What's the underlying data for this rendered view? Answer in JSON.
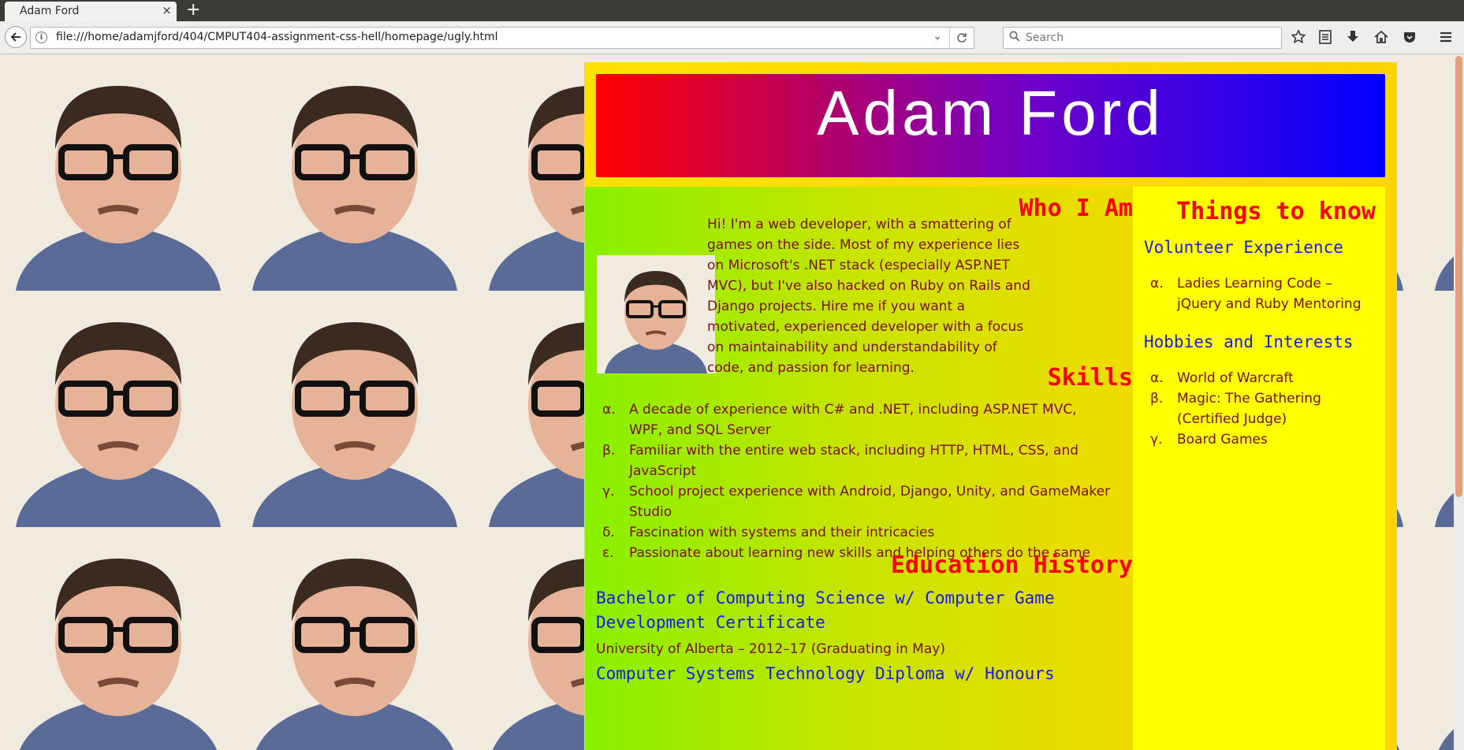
{
  "browser": {
    "tab_title": "Adam Ford",
    "tab_close": "×",
    "new_tab": "+",
    "url": "file:///home/adamjford/404/CMPUT404-assignment-css-hell/homepage/ugly.html",
    "url_dropdown": "⌄",
    "reload": "C",
    "search_placeholder": "Search",
    "toolbar_icons": [
      "bookmark-star-icon",
      "reading-list-icon",
      "download-icon",
      "home-icon",
      "pocket-icon",
      "menu-icon"
    ]
  },
  "page": {
    "name": "Adam Ford",
    "who_heading": "Who I Am",
    "intro": "Hi! I'm a web developer, with a smattering of games on the side. Most of my experience lies on Microsoft's .NET stack (especially ASP.NET MVC), but I've also hacked on Ruby on Rails and Django projects. Hire me if you want a motivated, experienced developer with a focus on maintainability and understandability of code, and passion for learning.",
    "skills_heading": "Skills",
    "skills": [
      {
        "marker": "α.",
        "lines": [
          "A decade of experience with C# and .NET, including ASP.NET MVC,",
          "WPF, and SQL Server"
        ]
      },
      {
        "marker": "β.",
        "lines": [
          "Familiar with the entire web stack, including HTTP, HTML, CSS, and",
          "JavaScript"
        ]
      },
      {
        "marker": "γ.",
        "lines": [
          "School project experience with Android, Django, Unity, and GameMaker",
          "Studio"
        ]
      },
      {
        "marker": "δ.",
        "lines": [
          "Fascination with systems and their intricacies"
        ]
      },
      {
        "marker": "ε.",
        "lines": [
          "Passionate about learning new skills and helping others do the same"
        ]
      }
    ],
    "education_heading": "Education History",
    "education": [
      {
        "degree_lines": [
          "Bachelor of Computing Science w/ Computer Game",
          "Development Certificate"
        ],
        "detail": "University of Alberta – 2012–17 (Graduating in May)"
      },
      {
        "degree_lines": [
          "Computer Systems Technology Diploma w/ Honours"
        ],
        "detail": ""
      }
    ],
    "things_heading": "Things to know",
    "volunteer_heading": "Volunteer Experience",
    "volunteer": [
      {
        "marker": "α.",
        "lines": [
          "Ladies Learning Code –",
          "jQuery and Ruby Mentoring"
        ]
      }
    ],
    "hobbies_heading": "Hobbies and Interests",
    "hobbies": [
      {
        "marker": "α.",
        "lines": [
          "World of Warcraft"
        ]
      },
      {
        "marker": "β.",
        "lines": [
          "Magic: The Gathering",
          "(Certified Judge)"
        ]
      },
      {
        "marker": "γ.",
        "lines": [
          "Board Games"
        ]
      }
    ]
  },
  "colors": {
    "banner_start": "#ff0000",
    "banner_end": "#0000ff",
    "heading_red": "#ff0000",
    "subheading_blue": "#1a1ad8",
    "body_text": "#7a1010",
    "card_yellow": "#ffd400",
    "right_col_yellow": "#ffff00",
    "left_col_green": "#88f000"
  }
}
